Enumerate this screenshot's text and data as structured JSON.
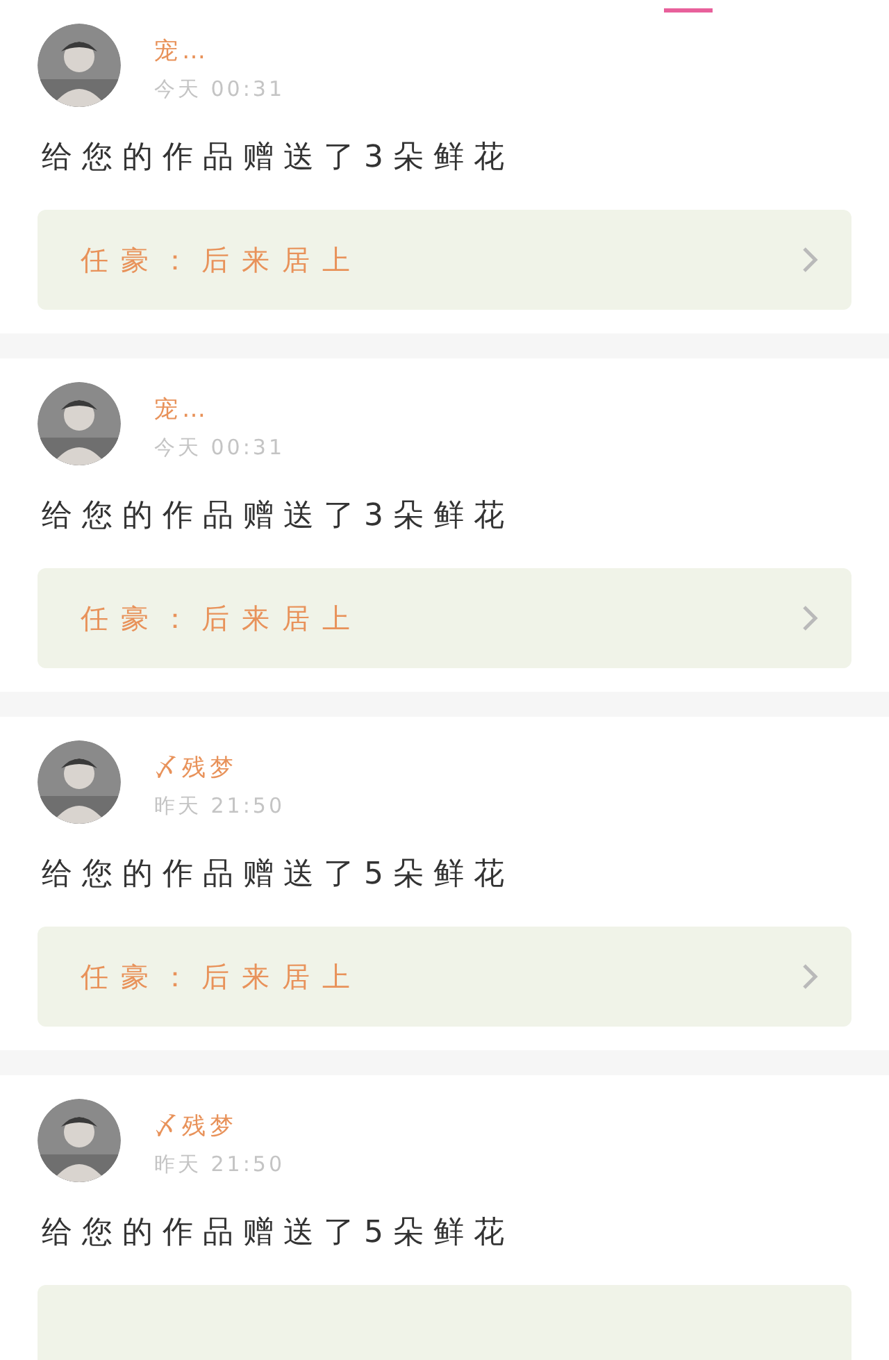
{
  "top_indicator": {
    "selected": true
  },
  "notifications": [
    {
      "user": "宠…",
      "time": "今天 00:31",
      "message": "给您的作品赠送了3朵鲜花",
      "work": "任豪：后来居上"
    },
    {
      "user": "宠…",
      "time": "今天 00:31",
      "message": "给您的作品赠送了3朵鲜花",
      "work": "任豪：后来居上"
    },
    {
      "user": "〆残梦",
      "time": "昨天 21:50",
      "message": "给您的作品赠送了5朵鲜花",
      "work": "任豪：后来居上"
    },
    {
      "user": "〆残梦",
      "time": "昨天 21:50",
      "message": "给您的作品赠送了5朵鲜花"
    }
  ]
}
